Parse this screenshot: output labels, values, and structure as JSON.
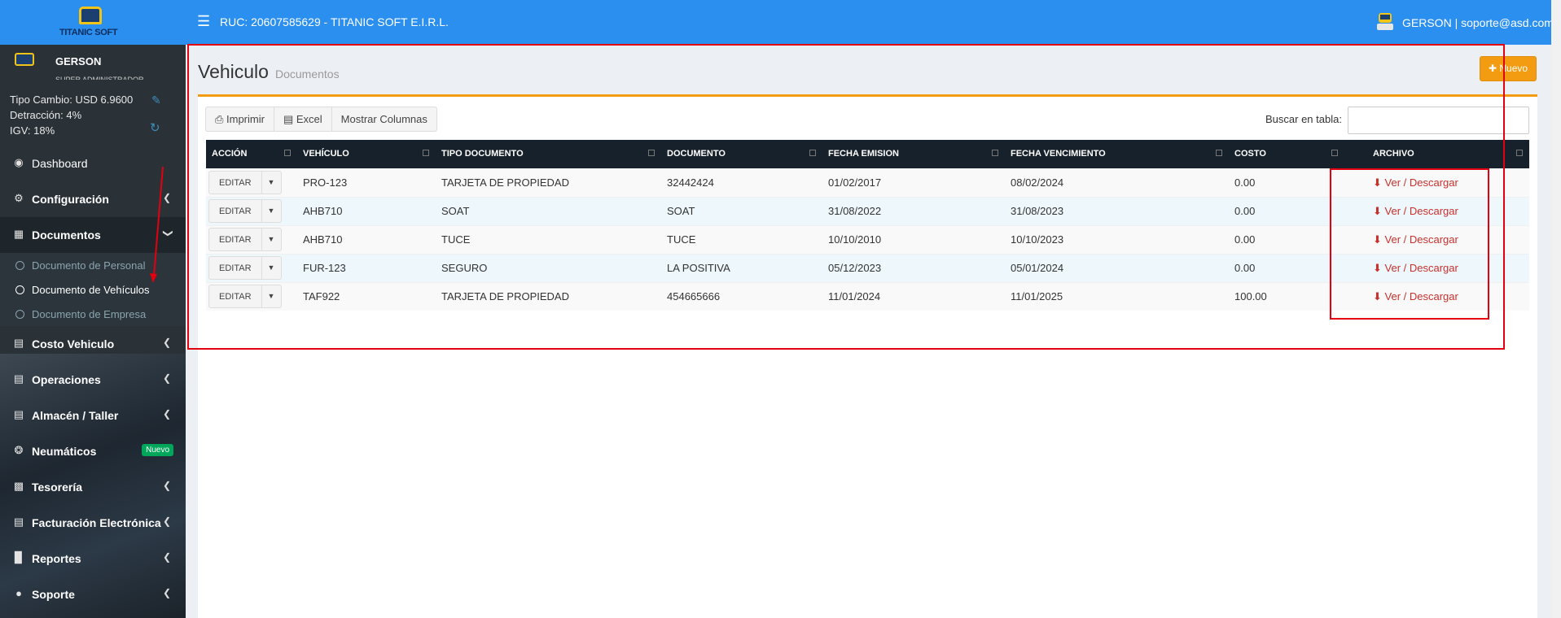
{
  "brand": {
    "name": "TITANIC SOFT"
  },
  "header": {
    "ruc_text": "RUC: 20607585629 - TITANIC SOFT E.I.R.L.",
    "user_text": "GERSON | soporte@asd.com"
  },
  "sidebar": {
    "user_name": "GERSON",
    "user_role": "SUPER ADMINISTRADOR",
    "tipo_cambio": "Tipo Cambio: USD 6.9600",
    "detraccion": "Detracción: 4%",
    "igv": "IGV: 18%",
    "items": [
      {
        "label": "Dashboard",
        "icon": "dashboard-icon"
      },
      {
        "label": "Configuración",
        "icon": "gears-icon"
      },
      {
        "label": "Documentos",
        "icon": "book-icon"
      },
      {
        "label": "Costo Vehiculo",
        "icon": "file-icon"
      },
      {
        "label": "Operaciones",
        "icon": "file-icon"
      },
      {
        "label": "Almacén / Taller",
        "icon": "file-icon"
      },
      {
        "label": "Neumáticos",
        "icon": "tire-icon",
        "badge": "Nuevo"
      },
      {
        "label": "Tesorería",
        "icon": "money-icon"
      },
      {
        "label": "Facturación Electrónica",
        "icon": "file-icon"
      },
      {
        "label": "Reportes",
        "icon": "chart-icon"
      },
      {
        "label": "Soporte",
        "icon": "support-icon"
      }
    ],
    "documentos_sub": [
      {
        "label": "Documento de Personal"
      },
      {
        "label": "Documento de Vehículos"
      },
      {
        "label": "Documento de Empresa"
      }
    ]
  },
  "page": {
    "title": "Vehiculo",
    "subtitle": "Documentos",
    "new_button": "Nuevo"
  },
  "toolbar": {
    "print_label": "Imprimir",
    "excel_label": "Excel",
    "columns_label": "Mostrar Columnas",
    "search_label": "Buscar en tabla:",
    "search_value": ""
  },
  "table": {
    "headers": [
      "ACCIÓN",
      "VEHÍCULO",
      "TIPO DOCUMENTO",
      "DOCUMENTO",
      "FECHA EMISION",
      "FECHA VENCIMIENTO",
      "COSTO",
      "ARCHIVO"
    ],
    "edit_label": "EDITAR",
    "file_label": "Ver / Descargar",
    "rows": [
      {
        "vehiculo": "PRO-123",
        "tipo": "TARJETA DE PROPIEDAD",
        "documento": "32442424",
        "emision": "01/02/2017",
        "vencimiento": "08/02/2024",
        "costo": "0.00"
      },
      {
        "vehiculo": "AHB710",
        "tipo": "SOAT",
        "documento": "SOAT",
        "emision": "31/08/2022",
        "vencimiento": "31/08/2023",
        "costo": "0.00"
      },
      {
        "vehiculo": "AHB710",
        "tipo": "TUCE",
        "documento": "TUCE",
        "emision": "10/10/2010",
        "vencimiento": "10/10/2023",
        "costo": "0.00"
      },
      {
        "vehiculo": "FUR-123",
        "tipo": "SEGURO",
        "documento": "LA POSITIVA",
        "emision": "05/12/2023",
        "vencimiento": "05/01/2024",
        "costo": "0.00"
      },
      {
        "vehiculo": "TAF922",
        "tipo": "TARJETA DE PROPIEDAD",
        "documento": "454665666",
        "emision": "11/01/2024",
        "vencimiento": "11/01/2025",
        "costo": "100.00"
      }
    ]
  },
  "colors": {
    "header_blue": "#2b8ff0",
    "sidebar": "#2a3238",
    "accent_orange": "#f39c12",
    "annotation_red": "#e3000f",
    "link_red": "#c9302c"
  }
}
